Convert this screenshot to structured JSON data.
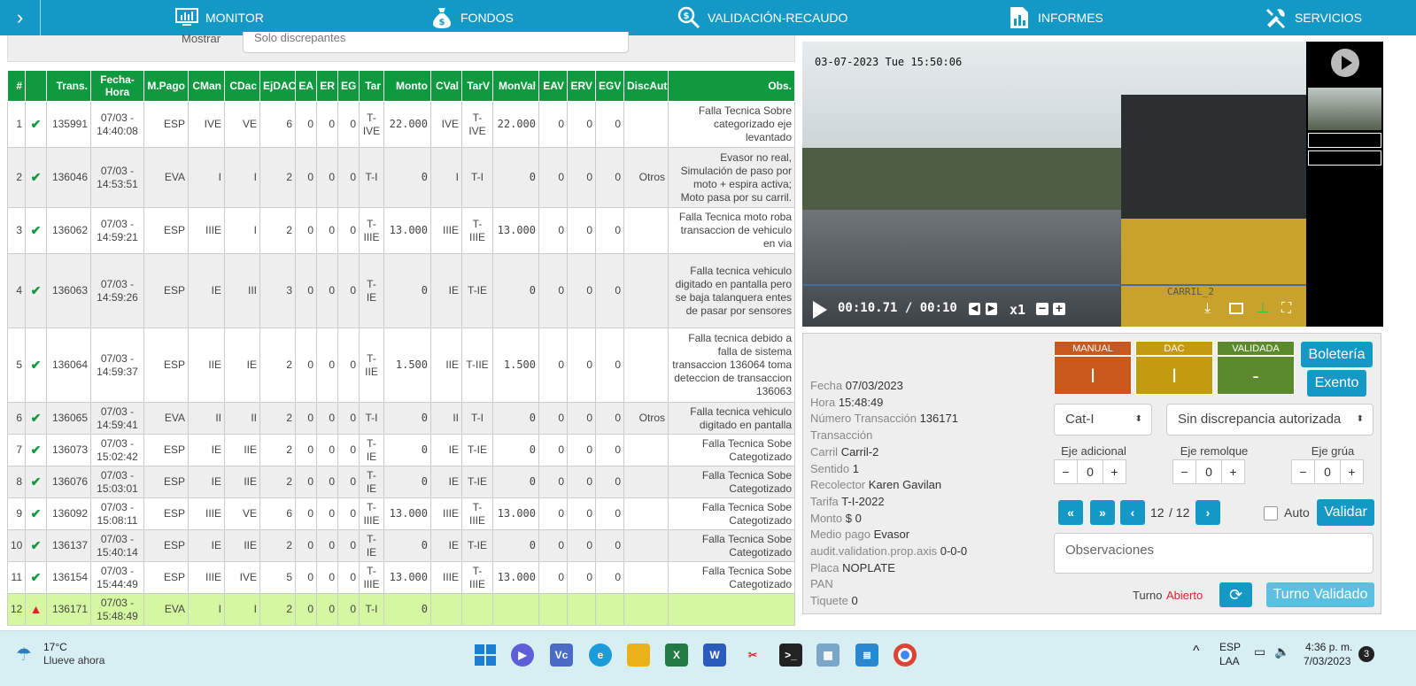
{
  "nav": {
    "items": [
      {
        "label": "MONITOR",
        "icon": "monitor-icon"
      },
      {
        "label": "FONDOS",
        "icon": "money-bag-icon"
      },
      {
        "label": "VALIDACIÓN-RECAUDO",
        "icon": "search-money-icon"
      },
      {
        "label": "INFORMES",
        "icon": "report-icon"
      },
      {
        "label": "SERVICIOS",
        "icon": "tools-icon"
      }
    ]
  },
  "filter": {
    "label": "Mostrar",
    "value": "Solo discrepantes"
  },
  "table": {
    "headers": [
      "#",
      "",
      "Trans.",
      "Fecha-Hora",
      "M.Pago",
      "CMan",
      "CDac",
      "EjDAC",
      "EA",
      "ER",
      "EG",
      "Tar",
      "Monto",
      "CVal",
      "TarV",
      "MonVal",
      "EAV",
      "ERV",
      "EGV",
      "DiscAut",
      "Obs."
    ],
    "rows": [
      {
        "n": "1",
        "status": "check",
        "trans": "135991",
        "fecha": "07/03 - 14:40:08",
        "pago": "ESP",
        "cman": "IVE",
        "cdac": "VE",
        "ejdac": "6",
        "ea": "0",
        "er": "0",
        "eg": "0",
        "tar": "T-IVE",
        "monto": "22.000",
        "cval": "IVE",
        "tarv": "T-IVE",
        "monval": "22.000",
        "eav": "0",
        "erv": "0",
        "egv": "0",
        "disc": "",
        "obs": "Falla Tecnica Sobre categorizado eje levantado"
      },
      {
        "n": "2",
        "status": "check",
        "trans": "136046",
        "fecha": "07/03 - 14:53:51",
        "pago": "EVA",
        "cman": "I",
        "cdac": "I",
        "ejdac": "2",
        "ea": "0",
        "er": "0",
        "eg": "0",
        "tar": "T-I",
        "monto": "0",
        "cval": "I",
        "tarv": "T-I",
        "monval": "0",
        "eav": "0",
        "erv": "0",
        "egv": "0",
        "disc": "Otros",
        "obs": "Evasor no real, Simulación de paso por moto + espira activa; Moto pasa por su carril."
      },
      {
        "n": "3",
        "status": "double",
        "trans": "136062",
        "fecha": "07/03 - 14:59:21",
        "pago": "ESP",
        "cman": "IIIE",
        "cdac": "I",
        "ejdac": "2",
        "ea": "0",
        "er": "0",
        "eg": "0",
        "tar": "T-IIIE",
        "monto": "13.000",
        "cval": "IIIE",
        "tarv": "T-IIIE",
        "monval": "13.000",
        "eav": "0",
        "erv": "0",
        "egv": "0",
        "disc": "",
        "obs": "Falla Tecnica moto roba transaccion de vehiculo en via"
      },
      {
        "n": "4",
        "status": "double",
        "trans": "136063",
        "fecha": "07/03 - 14:59:26",
        "pago": "ESP",
        "cman": "IE",
        "cdac": "III",
        "ejdac": "3",
        "ea": "0",
        "er": "0",
        "eg": "0",
        "tar": "T-IE",
        "monto": "0",
        "cval": "IE",
        "tarv": "T-IE",
        "monval": "0",
        "eav": "0",
        "erv": "0",
        "egv": "0",
        "disc": "",
        "obs": "Falla tecnica vehiculo digitado en pantalla pero se baja talanquera entes de pasar por sensores"
      },
      {
        "n": "5",
        "status": "double",
        "trans": "136064",
        "fecha": "07/03 - 14:59:37",
        "pago": "ESP",
        "cman": "IIE",
        "cdac": "IE",
        "ejdac": "2",
        "ea": "0",
        "er": "0",
        "eg": "0",
        "tar": "T-IIE",
        "monto": "1.500",
        "cval": "IIE",
        "tarv": "T-IIE",
        "monval": "1.500",
        "eav": "0",
        "erv": "0",
        "egv": "0",
        "disc": "",
        "obs": "Falla tecnica debido a falla de sistema transaccion 136064 toma deteccion de transaccion 136063"
      },
      {
        "n": "6",
        "status": "double",
        "trans": "136065",
        "fecha": "07/03 - 14:59:41",
        "pago": "EVA",
        "cman": "II",
        "cdac": "II",
        "ejdac": "2",
        "ea": "0",
        "er": "0",
        "eg": "0",
        "tar": "T-I",
        "monto": "0",
        "cval": "II",
        "tarv": "T-I",
        "monval": "0",
        "eav": "0",
        "erv": "0",
        "egv": "0",
        "disc": "Otros",
        "obs": "Falla tecnica vehiculo digitado en pantalla"
      },
      {
        "n": "7",
        "status": "check",
        "trans": "136073",
        "fecha": "07/03 - 15:02:42",
        "pago": "ESP",
        "cman": "IE",
        "cdac": "IIE",
        "ejdac": "2",
        "ea": "0",
        "er": "0",
        "eg": "0",
        "tar": "T-IE",
        "monto": "0",
        "cval": "IE",
        "tarv": "T-IE",
        "monval": "0",
        "eav": "0",
        "erv": "0",
        "egv": "0",
        "disc": "",
        "obs": "Falla Tecnica Sobe Categotizado"
      },
      {
        "n": "8",
        "status": "check",
        "trans": "136076",
        "fecha": "07/03 - 15:03:01",
        "pago": "ESP",
        "cman": "IE",
        "cdac": "IIE",
        "ejdac": "2",
        "ea": "0",
        "er": "0",
        "eg": "0",
        "tar": "T-IE",
        "monto": "0",
        "cval": "IE",
        "tarv": "T-IE",
        "monval": "0",
        "eav": "0",
        "erv": "0",
        "egv": "0",
        "disc": "",
        "obs": "Falla Tecnica Sobe Categotizado"
      },
      {
        "n": "9",
        "status": "check",
        "trans": "136092",
        "fecha": "07/03 - 15:08:11",
        "pago": "ESP",
        "cman": "IIIE",
        "cdac": "VE",
        "ejdac": "6",
        "ea": "0",
        "er": "0",
        "eg": "0",
        "tar": "T-IIIE",
        "monto": "13.000",
        "cval": "IIIE",
        "tarv": "T-IIIE",
        "monval": "13.000",
        "eav": "0",
        "erv": "0",
        "egv": "0",
        "disc": "",
        "obs": "Falla Tecnica Sobe Categotizado"
      },
      {
        "n": "10",
        "status": "check",
        "trans": "136137",
        "fecha": "07/03 - 15:40:14",
        "pago": "ESP",
        "cman": "IE",
        "cdac": "IIE",
        "ejdac": "2",
        "ea": "0",
        "er": "0",
        "eg": "0",
        "tar": "T-IE",
        "monto": "0",
        "cval": "IE",
        "tarv": "T-IE",
        "monval": "0",
        "eav": "0",
        "erv": "0",
        "egv": "0",
        "disc": "",
        "obs": "Falla Tecnica Sobe Categotizado"
      },
      {
        "n": "11",
        "status": "check",
        "trans": "136154",
        "fecha": "07/03 - 15:44:49",
        "pago": "ESP",
        "cman": "IIIE",
        "cdac": "IVE",
        "ejdac": "5",
        "ea": "0",
        "er": "0",
        "eg": "0",
        "tar": "T-IIIE",
        "monto": "13.000",
        "cval": "IIIE",
        "tarv": "T-IIIE",
        "monval": "13.000",
        "eav": "0",
        "erv": "0",
        "egv": "0",
        "disc": "",
        "obs": "Falla Tecnica Sobe Categotizado"
      },
      {
        "n": "12",
        "status": "warn",
        "trans": "136171",
        "fecha": "07/03 - 15:48:49",
        "pago": "EVA",
        "cman": "I",
        "cdac": "I",
        "ejdac": "2",
        "ea": "0",
        "er": "0",
        "eg": "0",
        "tar": "T-I",
        "monto": "0",
        "cval": "",
        "tarv": "",
        "monval": "",
        "eav": "",
        "erv": "",
        "egv": "",
        "disc": "",
        "obs": ""
      }
    ]
  },
  "video": {
    "timestamp": "03-07-2023 Tue 15:50:06",
    "camera": "CARRIL_2",
    "time": "00:10.71 / 00:10",
    "speed": "x1"
  },
  "detail": {
    "fields": [
      {
        "label": "Fecha",
        "value": "07/03/2023"
      },
      {
        "label": "Hora",
        "value": "15:48:49"
      },
      {
        "label": "Número Transacción",
        "value": "136171"
      },
      {
        "label": "Transacción",
        "value": ""
      },
      {
        "label": "Carril",
        "value": "Carril-2"
      },
      {
        "label": "Sentido",
        "value": "1"
      },
      {
        "label": "Recolector",
        "value": "Karen Gavilan"
      },
      {
        "label": "Tarifa",
        "value": "T-I-2022"
      },
      {
        "label": "Monto",
        "value": "$ 0"
      },
      {
        "label": "Medio pago",
        "value": "Evasor"
      },
      {
        "label": "audit.validation.prop.axis",
        "value": "0-0-0"
      },
      {
        "label": "Placa",
        "value": "NOPLATE"
      },
      {
        "label": "PAN",
        "value": ""
      },
      {
        "label": "Tiquete",
        "value": "0"
      }
    ],
    "boxes": [
      {
        "header": "MANUAL",
        "value": "I",
        "hcolor": "#c9581a",
        "bcolor": "#c9581a"
      },
      {
        "header": "DAC",
        "value": "I",
        "hcolor": "#c39a10",
        "bcolor": "#c39a10"
      },
      {
        "header": "VALIDADA",
        "value": "-",
        "hcolor": "#5a8a2c",
        "bcolor": "#5a8a2c"
      }
    ],
    "boleteria": "Boletería",
    "exento": "Exento",
    "category": "Cat-I",
    "discrepancy": "Sin discrepancia autorizada",
    "steppers": [
      {
        "label": "Eje adicional",
        "value": "0"
      },
      {
        "label": "Eje remolque",
        "value": "0"
      },
      {
        "label": "Eje grúa",
        "value": "0"
      }
    ],
    "page": "12",
    "total": "/ 12",
    "auto": "Auto",
    "validar": "Validar",
    "obs_placeholder": "Observaciones",
    "turno_label": "Turno",
    "turno_state": "Abierto",
    "turno_validado": "Turno Validado"
  },
  "taskbar": {
    "temp": "17°C",
    "weather": "Llueve ahora",
    "lang1": "ESP",
    "lang2": "LAA",
    "time": "4:36 p. m.",
    "date": "7/03/2023",
    "badge": "3"
  }
}
